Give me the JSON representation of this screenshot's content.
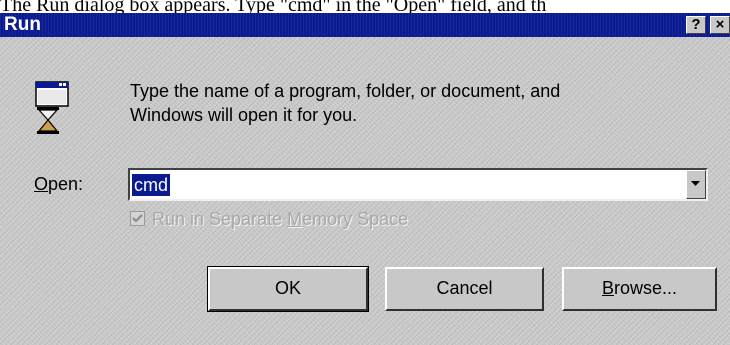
{
  "caption": "The Run dialog box appears. Type \"cmd\" in the \"Open\" field, and th",
  "dialog": {
    "title": "Run",
    "help_glyph": "?",
    "close_glyph": "×",
    "description_line1": "Type the name of a program, folder, or document, and",
    "description_line2": "Windows will open it for you.",
    "open_label_mnemonic": "O",
    "open_label_rest": "pen:",
    "open_value": "cmd",
    "checkbox_label_before": "Run in Separate ",
    "checkbox_label_mnemonic": "M",
    "checkbox_label_after": "emory Space",
    "checkbox_checked": true,
    "checkbox_enabled": false,
    "ok_label": "OK",
    "cancel_label": "Cancel",
    "browse_mnemonic": "B",
    "browse_rest": "rowse..."
  },
  "colors": {
    "titlebar": "#0a1a90",
    "face": "#c8c8c8",
    "selection": "#0a1a90"
  },
  "icons": {
    "run": "run-program-icon",
    "dropdown": "chevron-down-icon",
    "check": "check-icon",
    "help": "help-icon",
    "close": "close-icon"
  }
}
